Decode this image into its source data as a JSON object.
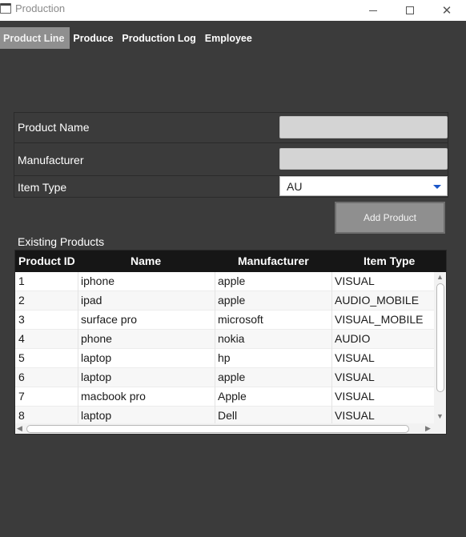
{
  "window": {
    "title": "Production",
    "icons": {
      "app": "window-icon",
      "minimize": "minimize-icon",
      "maximize": "maximize-icon",
      "close": "close-icon"
    }
  },
  "tabs": [
    {
      "label": "Product Line",
      "active": true
    },
    {
      "label": "Produce",
      "active": false
    },
    {
      "label": "Production Log",
      "active": false
    },
    {
      "label": "Employee",
      "active": false
    }
  ],
  "form": {
    "product_name_label": "Product Name",
    "product_name_value": "",
    "manufacturer_label": "Manufacturer",
    "manufacturer_value": "",
    "item_type_label": "Item Type",
    "item_type_value": "AU",
    "add_button": "Add Product"
  },
  "products": {
    "section_label": "Existing Products",
    "columns": [
      "Product ID",
      "Name",
      "Manufacturer",
      "Item Type"
    ],
    "rows": [
      [
        "1",
        "iphone",
        "apple",
        "VISUAL"
      ],
      [
        "2",
        "ipad",
        "apple",
        "AUDIO_MOBILE"
      ],
      [
        "3",
        "surface pro",
        "microsoft",
        "VISUAL_MOBILE"
      ],
      [
        "4",
        "phone",
        "nokia",
        "AUDIO"
      ],
      [
        "5",
        "laptop",
        "hp",
        "VISUAL"
      ],
      [
        "6",
        "laptop",
        "apple",
        "VISUAL"
      ],
      [
        "7",
        "macbook pro",
        "Apple",
        "VISUAL"
      ],
      [
        "8",
        "laptop",
        "Dell",
        "VISUAL"
      ]
    ]
  },
  "colors": {
    "background": "#3b3b3b",
    "active_tab": "#8f8f8f",
    "table_header": "#161616",
    "combo_arrow": "#1a56c8"
  }
}
